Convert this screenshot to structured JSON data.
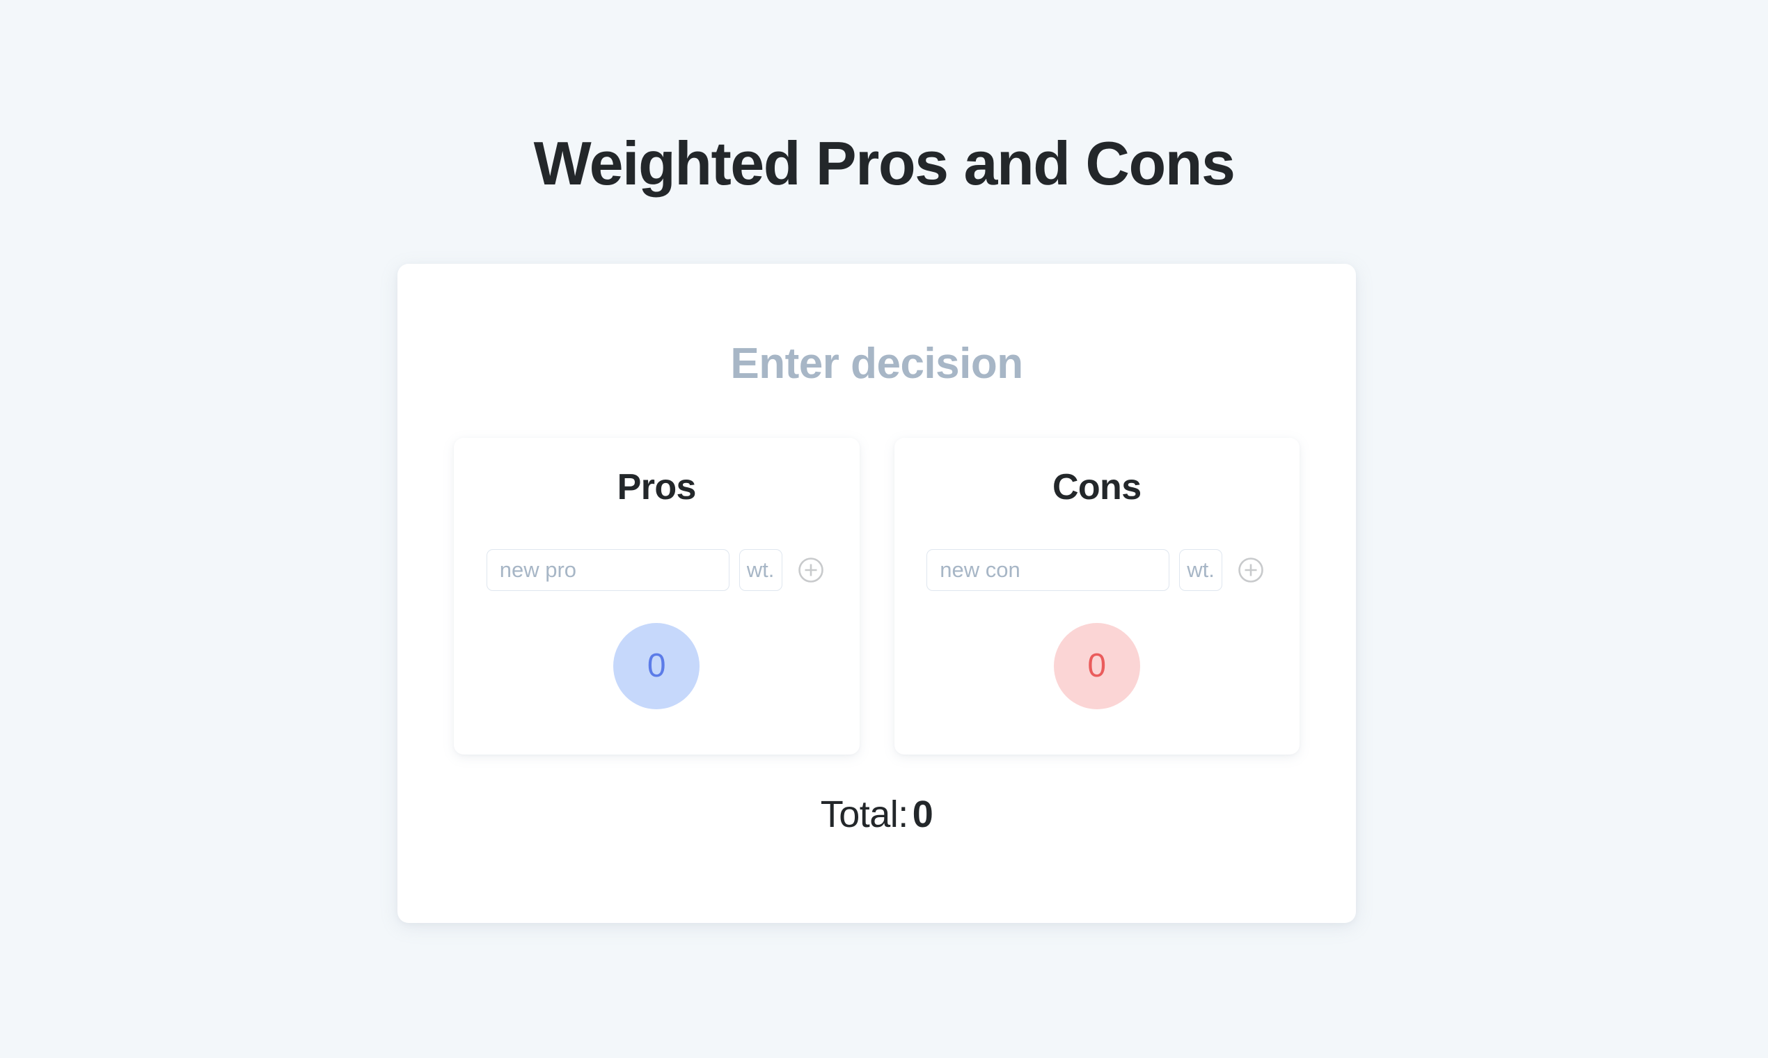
{
  "app": {
    "title": "Weighted Pros and Cons",
    "background_color": "#f3f7fa"
  },
  "decision": {
    "heading_placeholder": "Enter decision",
    "heading_color": "#a7b6c6"
  },
  "columns": [
    {
      "key": "pros",
      "title": "Pros",
      "item_placeholder": "new pro",
      "weight_placeholder": "wt.",
      "add_icon": "plus-circle-icon",
      "score": "0",
      "circle_bg": "#c6d8fb",
      "circle_fg": "#5c7ce8",
      "items": []
    },
    {
      "key": "cons",
      "title": "Cons",
      "item_placeholder": "new con",
      "weight_placeholder": "wt.",
      "add_icon": "plus-circle-icon",
      "score": "0",
      "circle_bg": "#fbd5d5",
      "circle_fg": "#ea5c5c",
      "items": []
    }
  ],
  "total": {
    "label": "Total:",
    "value": "0"
  }
}
